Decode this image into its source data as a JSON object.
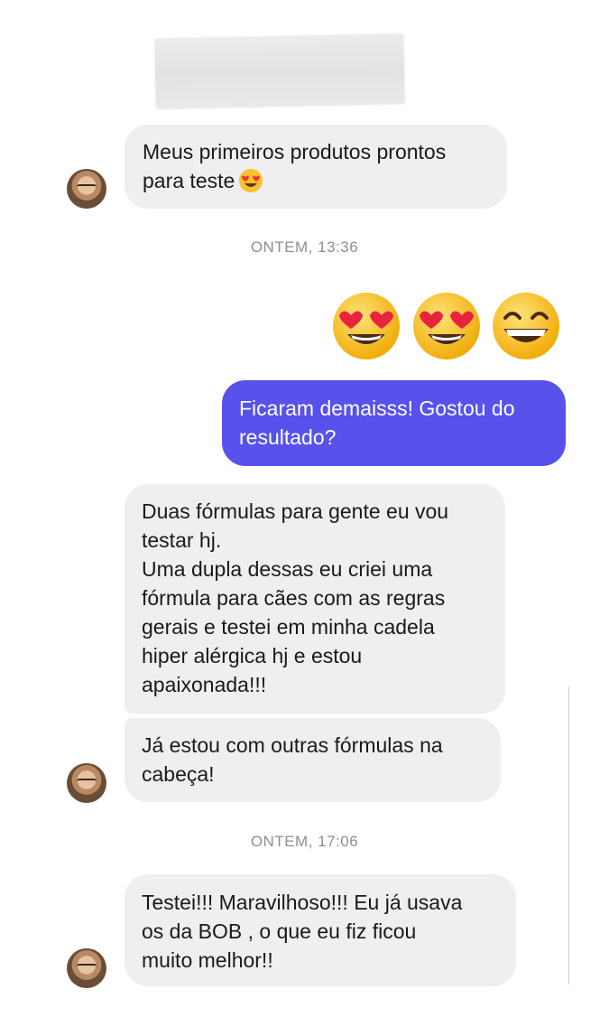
{
  "messages": [
    {
      "lines": [
        "Meus primeiros produtos prontos",
        "para teste"
      ],
      "emoji": "heart-eyes"
    },
    {
      "lines": [
        "Ficaram demaisss! Gostou do",
        "resultado?"
      ]
    },
    {
      "lines": [
        "Duas fórmulas para gente eu vou",
        "testar hj.",
        "Uma dupla dessas eu criei uma",
        "fórmula para cães com as regras",
        "gerais e testei em minha cadela",
        "hiper alérgica hj e estou",
        "apaixonada!!!"
      ]
    },
    {
      "lines": [
        "Já estou com outras fórmulas na",
        "cabeça!"
      ]
    },
    {
      "lines": [
        "Testei!!! Maravilhoso!!! Eu já usava",
        "os da BOB , o que eu fiz ficou",
        "muito melhor!!"
      ]
    }
  ],
  "timestamps": [
    "ONTEM, 13:36",
    "ONTEM, 17:06"
  ],
  "reaction_emojis": [
    "heart-eyes",
    "heart-eyes",
    "grinning-smile"
  ],
  "colors": {
    "outgoing": "#5851ec",
    "incoming": "#efefef"
  }
}
